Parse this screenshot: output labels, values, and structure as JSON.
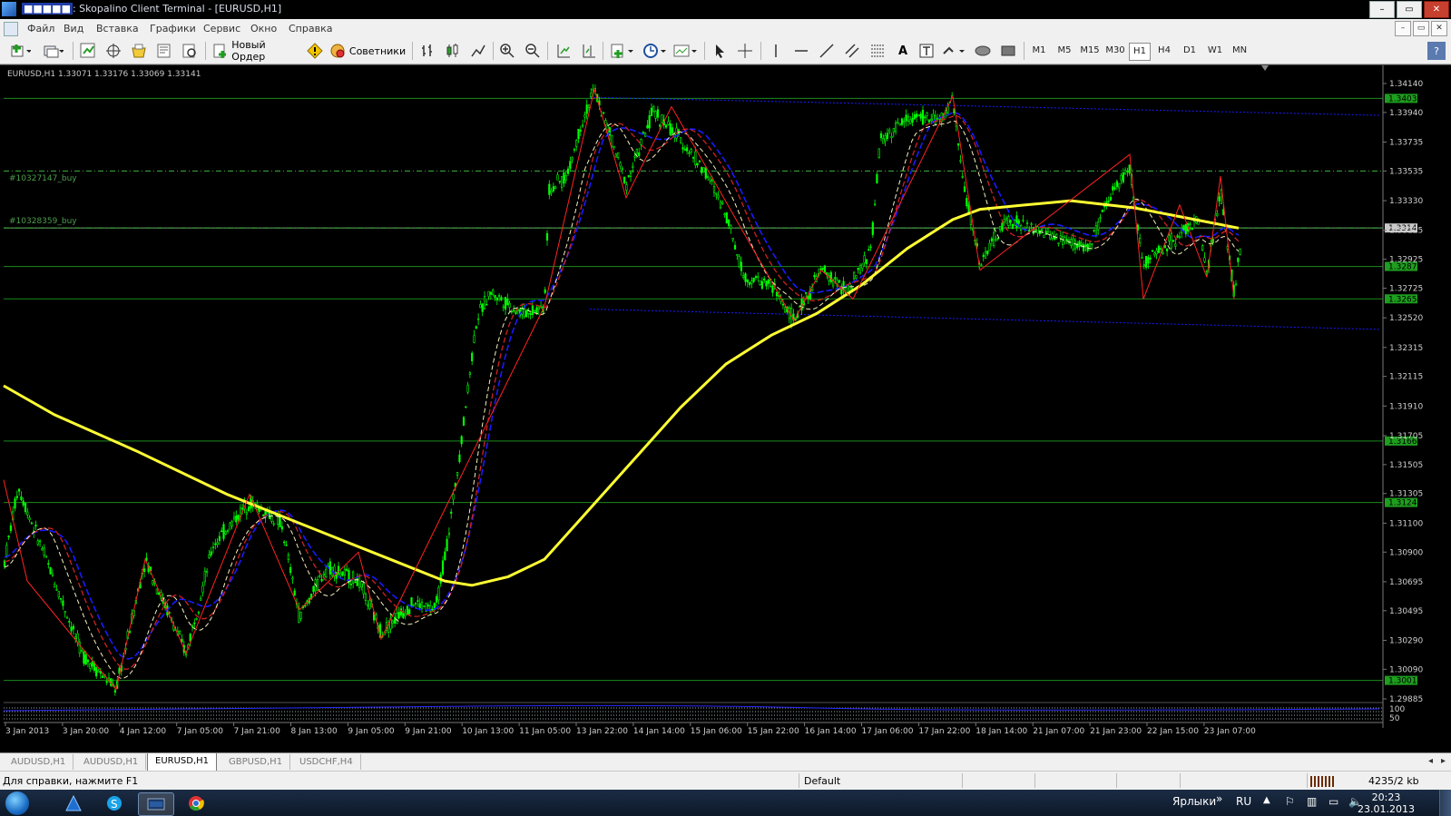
{
  "window": {
    "account_masked": "■■■■■",
    "title": "Skopalino Client Terminal - [EURUSD,H1]"
  },
  "window_buttons": [
    "–",
    "▭",
    "✕"
  ],
  "menu": {
    "items": [
      "Файл",
      "Вид",
      "Вставка",
      "Графики",
      "Сервис",
      "Окно",
      "Справка"
    ],
    "mdi_buttons": [
      "–",
      "▭",
      "✕"
    ]
  },
  "toolbar": {
    "new_order_label": "Новый Ордер",
    "experts_label": "Советники",
    "timeframes": [
      "M1",
      "M5",
      "M15",
      "M30",
      "H1",
      "H4",
      "D1",
      "W1",
      "MN"
    ],
    "active_timeframe": "H1"
  },
  "chart": {
    "symbol_info": "EURUSD,H1  1.33071 1.33176 1.33069 1.33141",
    "order_labels": [
      "#10327147_buy",
      "#10328359_buy"
    ],
    "price_axis": [
      "1.34140",
      "1.33940",
      "1.33735",
      "1.33535",
      "1.33330",
      "1.33125",
      "1.32925",
      "1.32725",
      "1.32520",
      "1.32315",
      "1.32115",
      "1.31910",
      "1.31705",
      "1.31505",
      "1.31305",
      "1.31100",
      "1.30900",
      "1.30695",
      "1.30495",
      "1.30290",
      "1.30090",
      "1.29885"
    ],
    "level_labels": [
      "1.34037",
      "1.33141",
      "1.32875",
      "1.32651",
      "1.31668",
      "1.31243",
      "1.30013"
    ],
    "current_price": "1.33141",
    "time_axis": [
      "3 Jan 2013",
      "3 Jan 20:00",
      "4 Jan 12:00",
      "7 Jan 05:00",
      "7 Jan 21:00",
      "8 Jan 13:00",
      "9 Jan 05:00",
      "9 Jan 21:00",
      "10 Jan 13:00",
      "11 Jan 05:00",
      "13 Jan 22:00",
      "14 Jan 14:00",
      "15 Jan 06:00",
      "15 Jan 22:00",
      "16 Jan 14:00",
      "17 Jan 06:00",
      "17 Jan 22:00",
      "18 Jan 14:00",
      "21 Jan 07:00",
      "21 Jan 23:00",
      "22 Jan 15:00",
      "23 Jan 07:00"
    ],
    "indicator_scale": [
      "100",
      "50"
    ],
    "colors": {
      "candles": "#00ff00",
      "ma_long": "#ffff33",
      "ma_blue": "#1a1aff",
      "ma_red": "#cc2222",
      "ma_cream": "#f5f0c0",
      "zigzag": "#ff2222",
      "levels": "#1b8a1b",
      "order_lines": "#3cb33c",
      "current_price_tag": "#c9c9c9"
    }
  },
  "chart_tabs": [
    "AUDUSD,H1",
    "AUDUSD,H1",
    "EURUSD,H1",
    "GBPUSD,H1",
    "USDCHF,H4"
  ],
  "active_tab": "EURUSD,H1",
  "status": {
    "help_text": "Для справки, нажмите F1",
    "profile": "Default",
    "traffic": "4235/2 kb"
  },
  "taskbar": {
    "toolbar_label": "Ярлыки",
    "lang": "RU",
    "time": "20:23",
    "date": "23.01.2013"
  }
}
